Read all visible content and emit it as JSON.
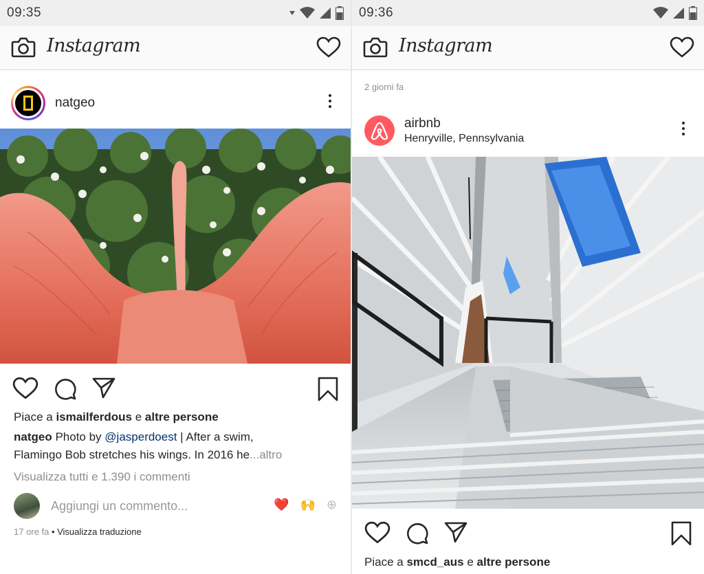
{
  "colors": {
    "heart_red": "#ed4956",
    "airbnb": "#ff5a5f",
    "link_blue": "#003569",
    "muted": "#8e8e8e"
  },
  "left": {
    "status": {
      "time": "09:35"
    },
    "appbar": {
      "brand": "Instagram",
      "left_icon": "camera-icon",
      "right_icon": "heart-icon"
    },
    "post": {
      "username": "natgeo",
      "likes": {
        "prefix": "Piace a ",
        "user": "ismailferdous",
        "mid": " e ",
        "rest": "altre persone"
      },
      "caption": {
        "user": "natgeo",
        "text1": " Photo by ",
        "mention": "@jasperdoest",
        "text2": " | After a swim,",
        "line2": "Flamingo Bob stretches his wings. In 2016 he",
        "more": "...altro"
      },
      "view_comments": "Visualizza tutti e 1.390 i commenti",
      "comment_placeholder": "Aggiungi un commento...",
      "reactions": [
        "❤️",
        "🙌",
        "⊕"
      ],
      "time_ago": "17 ore fa",
      "translate": " • Visualizza traduzione"
    }
  },
  "right": {
    "status": {
      "time": "09:36"
    },
    "appbar": {
      "brand": "Instagram"
    },
    "prev_time": "2 giorni fa",
    "post": {
      "username": "airbnb",
      "location": "Henryville, Pennsylvania",
      "likes": {
        "prefix": "Piace a ",
        "user": "smcd_aus",
        "mid": " e ",
        "rest": "altre persone"
      }
    }
  }
}
